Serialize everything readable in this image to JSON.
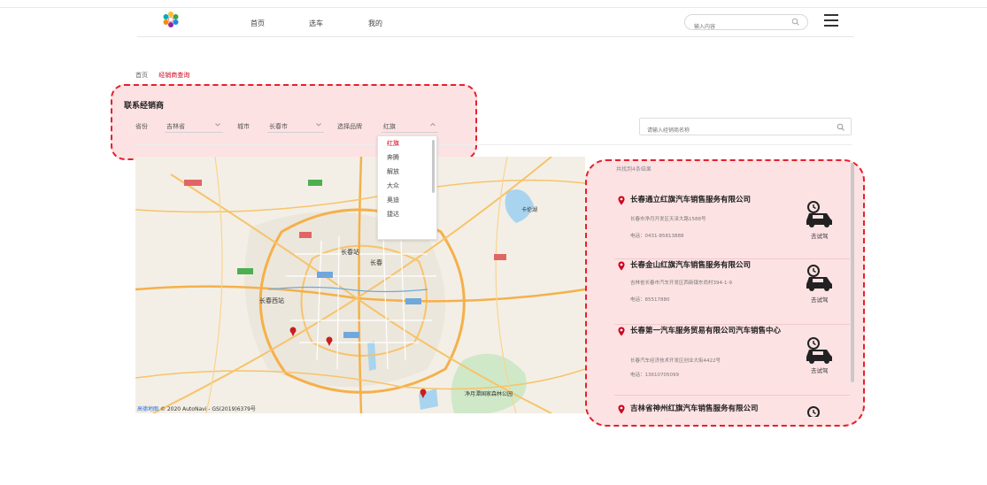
{
  "header": {
    "nav": [
      "首页",
      "选车",
      "我的"
    ],
    "search_placeholder": "输入内容"
  },
  "breadcrumb": {
    "home": "首页",
    "current": "经销商查询"
  },
  "filter": {
    "title": "联系经销商",
    "province_label": "省份",
    "province_value": "吉林省",
    "city_label": "城市",
    "city_value": "长春市",
    "brand_label": "选择品牌",
    "brand_value": "红旗",
    "brand_options": [
      "红旗",
      "奔腾",
      "解放",
      "大众",
      "奥迪",
      "捷达"
    ],
    "dealer_search_placeholder": "请输入经销商名称"
  },
  "map": {
    "copyright": "© 2020 AutoNavi - GS(2019)6379号",
    "brand": "高德地图",
    "labels": {
      "changchun_station": "长春站",
      "changchun_west": "长春西站",
      "city": "长春",
      "park": "净月潭国家森林公园",
      "lake": "卡伦湖"
    }
  },
  "results": {
    "count_text": "共找到4条结果",
    "test_drive": "去试驾",
    "dealers": [
      {
        "name": "长春通立红旗汽车销售服务有限公司",
        "address": "长春市净月开发区天泽大路1588号",
        "phone": "电话：0431-85813888"
      },
      {
        "name": "长春金山红旗汽车销售服务有限公司",
        "address": "吉林省长春市汽车开发区西新镇东尚村394-1-9",
        "phone": "电话：85517880"
      },
      {
        "name": "长春第一汽车服务贸易有限公司汽车销售中心",
        "address": "长春汽车经济技术开发区创业大街4422号",
        "phone": "电话：13610705099"
      },
      {
        "name": "吉林省神州红旗汽车销售服务有限公司",
        "address": "",
        "phone": ""
      }
    ]
  },
  "colors": {
    "accent": "#d0021b",
    "highlight": "#fde2e4",
    "dashed": "#e5202a"
  }
}
